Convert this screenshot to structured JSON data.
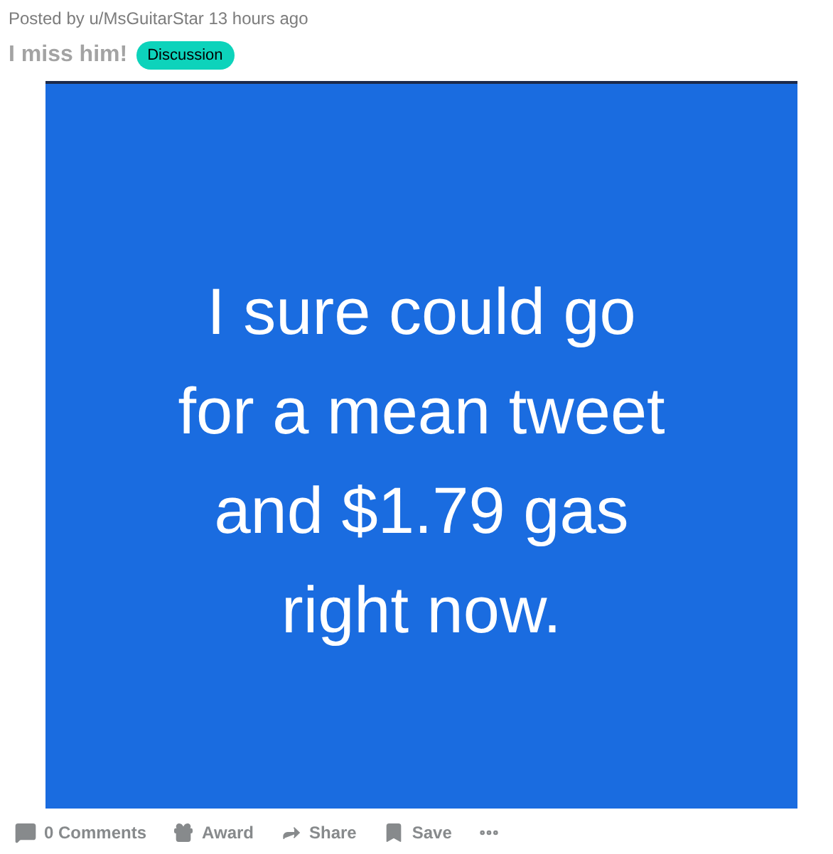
{
  "post": {
    "meta": "Posted by u/MsGuitarStar 13 hours ago",
    "title": "I miss him!",
    "flair": {
      "label": "Discussion",
      "color": "#0dd3bb"
    },
    "image_text": [
      "I sure could go",
      "for a mean tweet",
      "and $1.79 gas",
      "right now."
    ],
    "actions": [
      {
        "kind": "comments",
        "label": "0 Comments"
      },
      {
        "kind": "award",
        "label": "Award"
      },
      {
        "kind": "share",
        "label": "Share"
      },
      {
        "kind": "save",
        "label": "Save"
      },
      {
        "kind": "more"
      }
    ]
  }
}
